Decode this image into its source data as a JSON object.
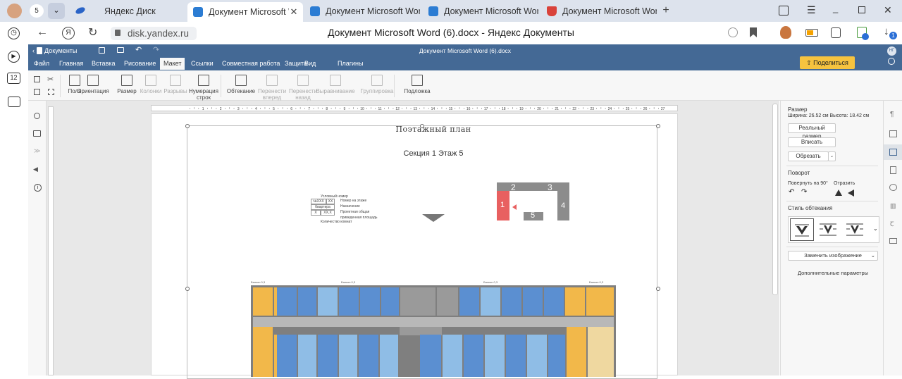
{
  "browser": {
    "profile_badge": "5",
    "tabs": [
      {
        "title": "Яндекс Диск",
        "icon_color": "#2a64c7",
        "active": false
      },
      {
        "title": "Документ Microsoft Wo",
        "icon_color": "#2b7cd3",
        "active": true
      },
      {
        "title": "Документ Microsoft Word",
        "icon_color": "#2b7cd3",
        "active": false
      },
      {
        "title": "Документ Microsoft Word",
        "icon_color": "#2b7cd3",
        "active": false
      },
      {
        "title": "Документ Microsoft Word",
        "icon_color": "#d9423a",
        "active": false
      }
    ],
    "url": "disk.yandex.ru",
    "page_title": "Документ Microsoft Word (6).docx - Яндекс Документы",
    "notification_count": "1",
    "side_count": "12"
  },
  "app": {
    "back_label": "Документы",
    "doc_title": "Документ Microsoft Word (6).docx",
    "share_label": "Поделиться",
    "user_initials": "НГ",
    "menu": [
      "Файл",
      "Главная",
      "Вставка",
      "Рисование",
      "Макет",
      "Ссылки",
      "Совместная работа",
      "Защита",
      "Вид",
      "Плагины"
    ],
    "active_menu": "Макет",
    "toolbar": [
      {
        "label": "Поля",
        "enabled": true
      },
      {
        "label": "Ориентация",
        "enabled": true
      },
      {
        "label": "Размер",
        "enabled": true
      },
      {
        "label": "Колонки",
        "enabled": false
      },
      {
        "label": "Разрывы",
        "enabled": false
      },
      {
        "label": "Нумерация строк",
        "enabled": true
      },
      {
        "label": "Обтекание",
        "enabled": true
      },
      {
        "label": "Перенести вперед",
        "enabled": false
      },
      {
        "label": "Перенести назад",
        "enabled": false
      },
      {
        "label": "Выравнивание",
        "enabled": false
      },
      {
        "label": "Группировка",
        "enabled": false
      },
      {
        "label": "Подложка",
        "enabled": true
      }
    ]
  },
  "ruler_labels": [
    "1",
    "2",
    "3",
    "4",
    "5",
    "6",
    "7",
    "8",
    "9",
    "10",
    "11",
    "12",
    "13",
    "14",
    "15",
    "16",
    "17",
    "18",
    "19",
    "20",
    "21",
    "22",
    "23",
    "24",
    "25",
    "26",
    "27"
  ],
  "document": {
    "title": "Поэтажный план",
    "subtitle": "Секция 1 Этаж 5",
    "legend": {
      "top": "Условный номер",
      "rows": [
        [
          "№XXX",
          "XX",
          "Номер на этаже"
        ],
        [
          "Квартира",
          "",
          "Назначение"
        ],
        [
          "X",
          "XX,X",
          "Проектная общая"
        ]
      ],
      "extra": "приведенная площадь",
      "bottom": "Количество комнат"
    },
    "sections": [
      "1",
      "2",
      "3",
      "4",
      "5"
    ],
    "balcony_label": "Балкон 0,3"
  },
  "panel": {
    "size_title": "Размер",
    "size_info": "Ширина: 26.52 см  Высота: 18.42 см",
    "real_size": "Реальный размер",
    "fit": "Вписать",
    "crop": "Обрезать",
    "rotate_title": "Поворот",
    "rotate_label": "Повернуть на 90°",
    "flip_label": "Отразить",
    "wrap_title": "Стиль обтекания",
    "replace": "Заменить изображение",
    "more": "Дополнительные параметры"
  }
}
